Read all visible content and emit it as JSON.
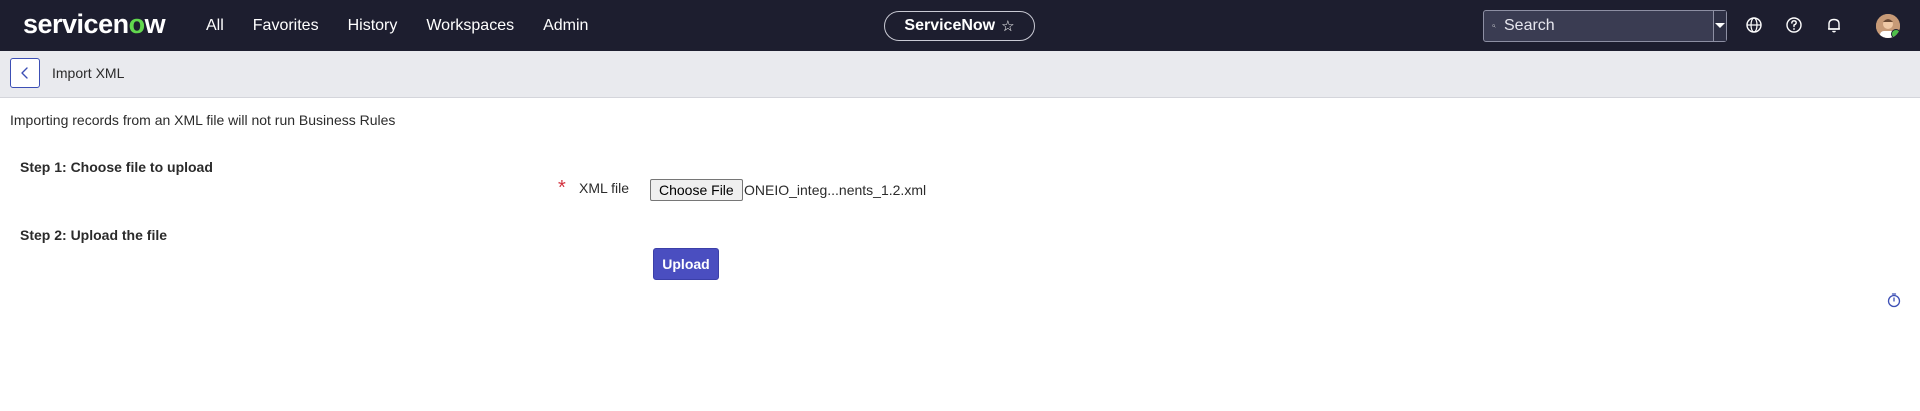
{
  "brand": {
    "logo_text_a": "servicen",
    "logo_ring": "o",
    "logo_text_b": "w"
  },
  "nav": {
    "items": [
      "All",
      "Favorites",
      "History",
      "Workspaces",
      "Admin"
    ]
  },
  "app_pill": {
    "label": "ServiceNow"
  },
  "search": {
    "placeholder": "Search"
  },
  "subheader": {
    "title": "Import XML"
  },
  "form": {
    "notice": "Importing records from an XML file will not run Business Rules",
    "step1_label": "Step 1: Choose file to upload",
    "required_mark": "*",
    "xml_label": "XML file",
    "choose_file_label": "Choose File",
    "file_name": "ONEIO_integ...nents_1.2.xml",
    "step2_label": "Step 2: Upload the file",
    "upload_label": "Upload"
  },
  "icons": {
    "search": "search-icon",
    "dropdown": "chevron-down-icon",
    "globe": "globe-icon",
    "help": "help-icon",
    "notifications": "bell-icon",
    "favorite": "star-icon",
    "back": "chevron-left-icon",
    "timer": "timer-icon"
  },
  "colors": {
    "topbar": "#1d1e2f",
    "accent": "#4a4ec0",
    "required": "#d3323f",
    "logo_ring": "#62d84e"
  }
}
